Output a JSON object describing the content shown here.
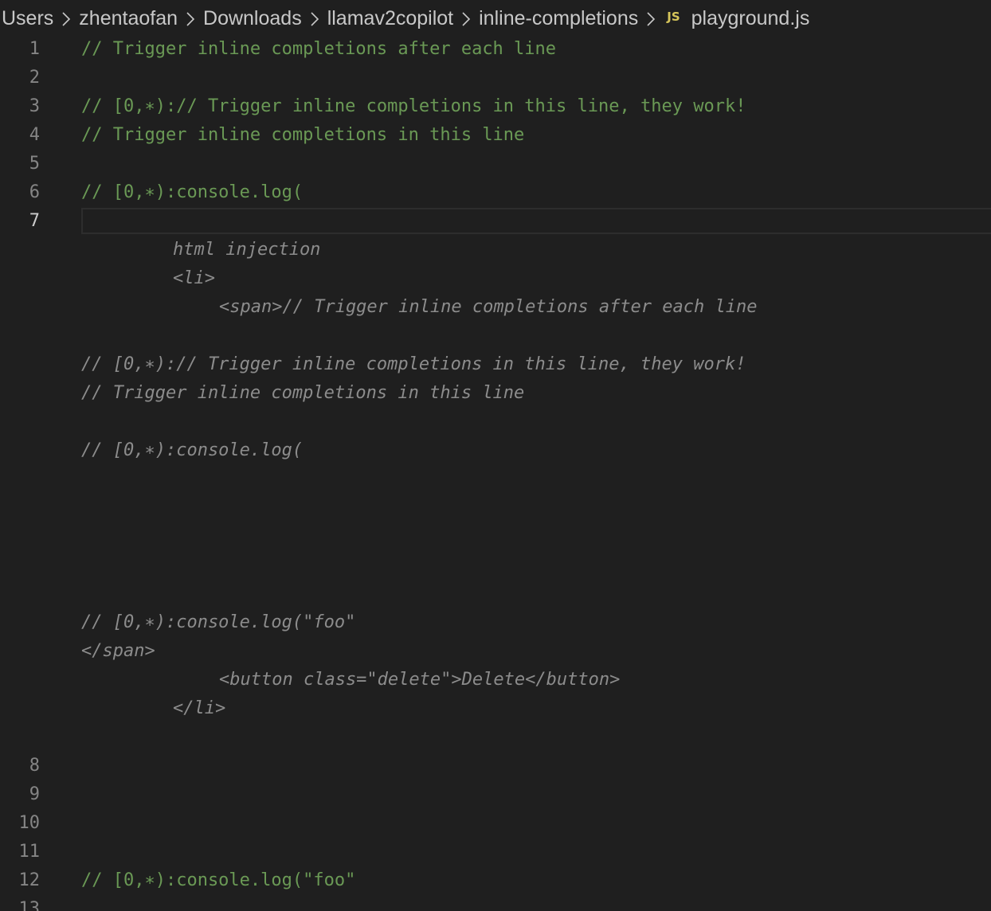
{
  "breadcrumb": {
    "items": [
      "Users",
      "zhentaofan",
      "Downloads",
      "llamav2copilot",
      "inline-completions"
    ],
    "file_badge": "JS",
    "file_name": "playground.js"
  },
  "editor": {
    "active_line": "7",
    "lines": [
      {
        "number": "1",
        "text": "// Trigger inline completions after each line"
      },
      {
        "number": "2",
        "text": ""
      },
      {
        "number": "3",
        "text": "// [0,∗):// Trigger inline completions in this line, they work!"
      },
      {
        "number": "4",
        "text": "// Trigger inline completions in this line"
      },
      {
        "number": "5",
        "text": ""
      },
      {
        "number": "6",
        "text": "// [0,∗):console.log("
      },
      {
        "number": "7",
        "text": ""
      },
      {
        "number": "8",
        "text": ""
      },
      {
        "number": "9",
        "text": ""
      },
      {
        "number": "10",
        "text": ""
      },
      {
        "number": "11",
        "text": ""
      },
      {
        "number": "12",
        "text": "// [0,∗):console.log(\"foo\""
      },
      {
        "number": "13",
        "text": ""
      }
    ],
    "ghost_lines": [
      "html injection",
      "<li>",
      "<span>// Trigger inline completions after each line",
      "// [0,∗):// Trigger inline completions in this line, they work!",
      "// Trigger inline completions in this line",
      "// [0,∗):console.log(",
      "// [0,∗):console.log(\"foo\"",
      "</span>",
      "<button class=\"delete\">Delete</button>",
      "</li>"
    ]
  }
}
